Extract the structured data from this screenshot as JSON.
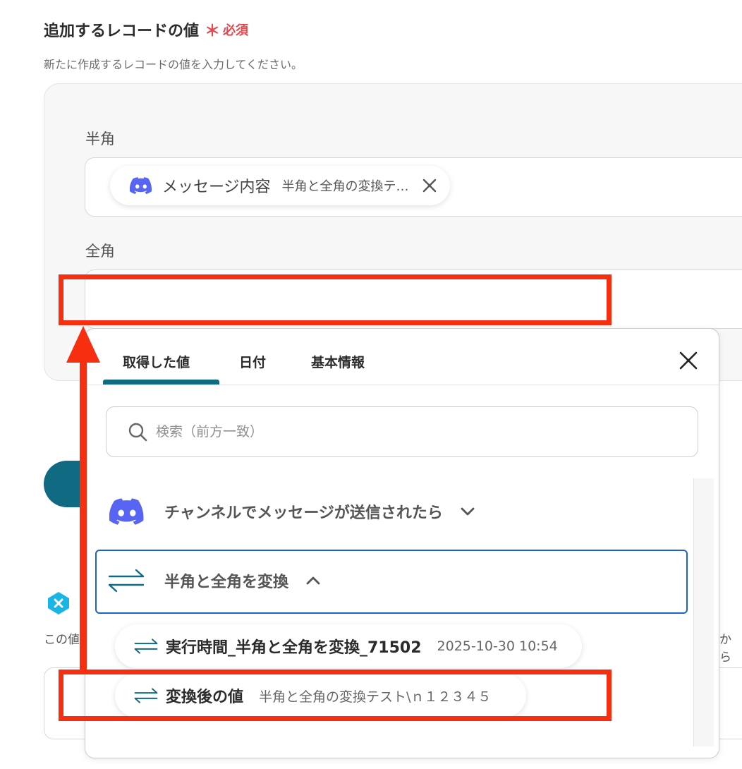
{
  "section": {
    "title": "追加するレコードの値",
    "required_mark": "＊",
    "required_label": "必須",
    "description": "新たに作成するレコードの値を入力してください。"
  },
  "fields": {
    "hankaku": {
      "label": "半角",
      "chip_title": "メッセージ内容",
      "chip_value": "半角と全角の変換テ…"
    },
    "zenkaku": {
      "label": "全角",
      "value": ""
    }
  },
  "background_fragments": {
    "desc_left": "この値",
    "desc_right": "から"
  },
  "dropdown": {
    "tabs": [
      "取得した値",
      "日付",
      "基本情報"
    ],
    "active_tab": "取得した値",
    "search_placeholder": "検索（前方一致）",
    "groups": [
      {
        "label": "チャンネルでメッセージが送信されたら",
        "icon": "discord-icon",
        "expanded": false
      },
      {
        "label": "半角と全角を変換",
        "icon": "convert-arrows-icon",
        "expanded": true
      }
    ],
    "items": [
      {
        "title": "実行時間_半角と全角を変換_71502",
        "value": "2025-10-30 10:54"
      },
      {
        "title": "変換後の値",
        "value": "半角と全角の変換テスト\\ｎ１２３４５"
      }
    ]
  },
  "colors": {
    "accent_teal": "#0f6a82",
    "required_red": "#e5484d",
    "highlight_red": "#f52f0f",
    "discord_blue": "#5865f2",
    "selected_border": "#1d63c9"
  }
}
